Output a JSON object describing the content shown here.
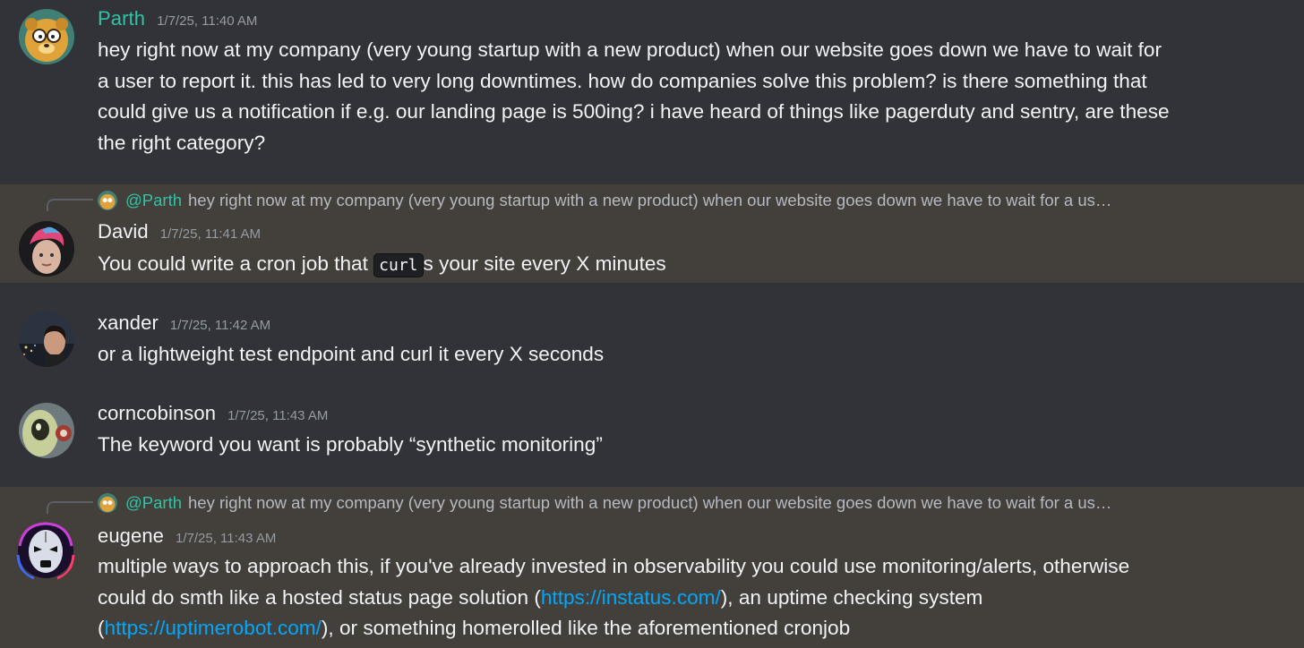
{
  "messages": [
    {
      "author": "Parth",
      "timestamp": "1/7/25, 11:40 AM",
      "avatar_icon": "yellow-cartoon-bear-avatar",
      "author_color": "#2fc4a4",
      "lines": [
        "hey right now at my company (very young startup with a new product) when our website goes down we have to wait for",
        "a user to report it. this has led to very long downtimes. how do companies solve this problem? is there something that",
        "could give us a notification if e.g. our landing page is 500ing? i have heard of things like pagerduty and sentry, are these",
        "the right category?"
      ]
    },
    {
      "author": "David",
      "timestamp": "1/7/25, 11:41 AM",
      "avatar_icon": "photo-avatar-pink-hair",
      "highlighted": true,
      "reply": {
        "author": "@Parth",
        "text": "hey right now at my company (very young startup with a new product) when our website goes down we have to wait for a us…"
      },
      "text_before": "You could write a cron job that ",
      "code": "curl",
      "text_after": "s your site every X minutes"
    },
    {
      "author": "xander",
      "timestamp": "1/7/25, 11:42 AM",
      "avatar_icon": "photo-avatar-person-night-city",
      "text": "or a lightweight test endpoint and curl it every X seconds"
    },
    {
      "author": "corncobinson",
      "timestamp": "1/7/25, 11:43 AM",
      "avatar_icon": "green-alien-avatar",
      "text": "The keyword you want is probably “synthetic monitoring”"
    },
    {
      "author": "eugene",
      "timestamp": "1/7/25, 11:43 AM",
      "avatar_icon": "neon-robot-face-avatar",
      "highlighted": true,
      "reply": {
        "author": "@Parth",
        "text": "hey right now at my company (very young startup with a new product) when our website goes down we have to wait for a us…"
      },
      "line1": "multiple ways to approach this, if you've already invested in observability you could use monitoring/alerts, otherwise",
      "line2_before": "could do smth like a hosted status page solution (",
      "link1": "https://instatus.com/",
      "line2_after": "), an uptime checking system",
      "line3_before": "(",
      "link2": "https://uptimerobot.com/",
      "line3_after": "), or something homerolled like the aforementioned cronjob"
    }
  ],
  "colors": {
    "background": "#313338",
    "highlight": "#433f3a",
    "mention_teal": "#2fc4a4",
    "link": "#00a8fc",
    "timestamp": "#949ba4"
  }
}
